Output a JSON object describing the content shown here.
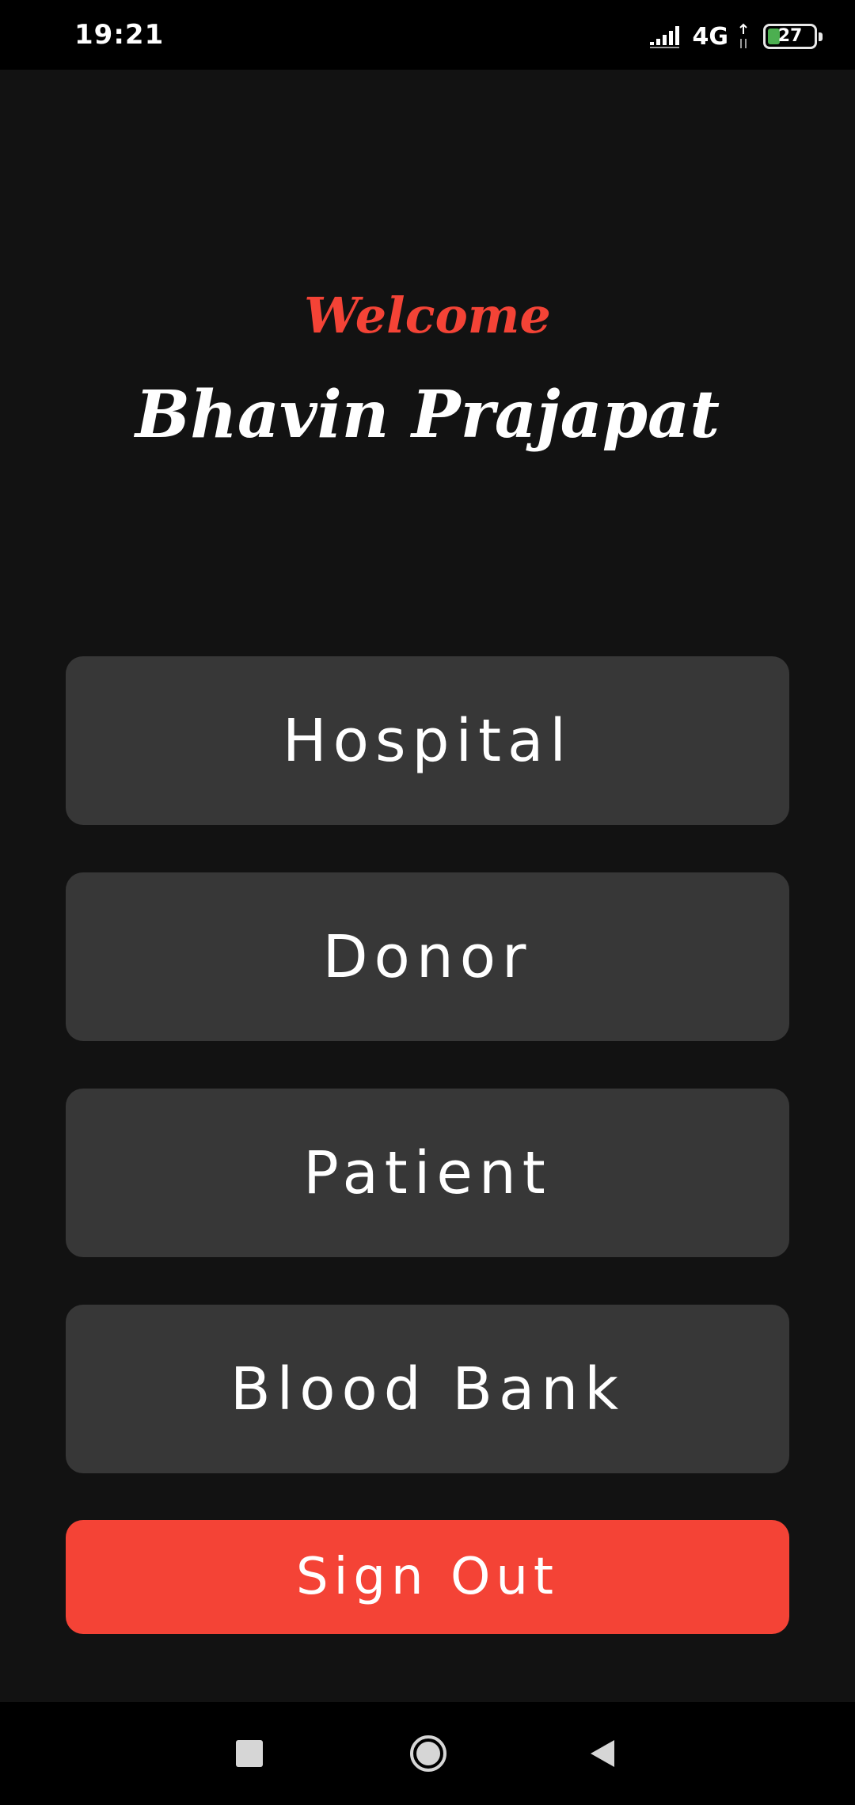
{
  "status_bar": {
    "time": "19:21",
    "network": "4G",
    "battery_level": "27",
    "battery_fraction": 0.27,
    "icons": [
      "signal-icon",
      "data-arrows-icon",
      "battery-icon"
    ]
  },
  "greeting": {
    "welcome": "Welcome",
    "user_name": "Bhavin Prajapat"
  },
  "menu": {
    "items": [
      {
        "label": "Hospital"
      },
      {
        "label": "Donor"
      },
      {
        "label": "Patient"
      },
      {
        "label": "Blood Bank"
      }
    ],
    "sign_out": "Sign Out"
  },
  "nav_bar": {
    "icons": [
      "recents-icon",
      "home-icon",
      "back-icon"
    ]
  },
  "colors": {
    "accent": "#f44336",
    "background": "#121212",
    "button": "#373737",
    "text": "#ffffff"
  }
}
